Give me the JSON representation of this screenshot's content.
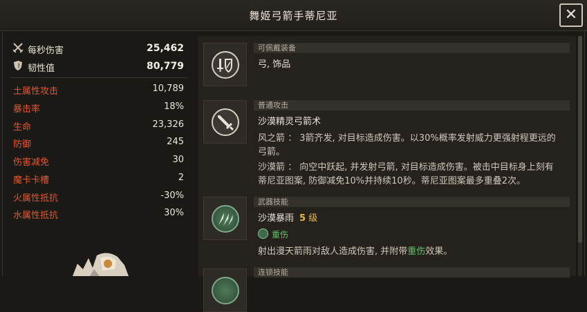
{
  "window": {
    "title": "舞姬弓箭手蒂尼亚",
    "close_label": "✕"
  },
  "stats": {
    "main": [
      {
        "label": "每秒伤害",
        "value": "25,462",
        "icon": "crossed-swords-icon"
      },
      {
        "label": "韧性值",
        "value": "80,779",
        "icon": "shield-icon"
      }
    ],
    "sub": [
      {
        "label": "土属性攻击",
        "value": "10,789"
      },
      {
        "label": "暴击率",
        "value": "18%"
      },
      {
        "label": "生命",
        "value": "23,326"
      },
      {
        "label": "防御",
        "value": "245"
      },
      {
        "label": "伤害减免",
        "value": "30"
      },
      {
        "label": "魔卡卡槽",
        "value": "2"
      },
      {
        "label": "火属性抵抗",
        "value": "-30%"
      },
      {
        "label": "水属性抵抗",
        "value": "30%"
      }
    ]
  },
  "equip": {
    "header": "可佩戴装备",
    "text": "弓, 饰品",
    "icon": "sword-shield-icon"
  },
  "normal_attack": {
    "header": "普通攻击",
    "name": "沙漠精灵弓箭术",
    "lines": [
      "风之箭 ： 3箭齐发, 对目标造成伤害。以30%概率发射威力更强射程更远的",
      "弓箭。",
      "沙漠箭 ： 向空中跃起, 并发射弓箭, 对目标造成伤害。被击中目标身上刻有",
      "蒂尼亚图案, 防御减免10%并持续10秒。蒂尼亚图案最多重叠2次。"
    ],
    "icon": "sword-icon"
  },
  "weapon_skill": {
    "header": "武器技能",
    "name": "沙漠暴雨",
    "level_num": "5",
    "level_unit": "级",
    "effect": "重伤",
    "desc_pre": "射出漫天箭雨对敌人造成伤害, 并附带",
    "desc_hl": "重伤",
    "desc_post": "效果。",
    "icon": "arrow-rain-icon"
  },
  "chain_skill": {
    "header": "连锁技能"
  },
  "colors": {
    "attribute_red": "#e6562e",
    "highlight_green": "#5fc46a",
    "level_gold": "#e6b84c"
  }
}
